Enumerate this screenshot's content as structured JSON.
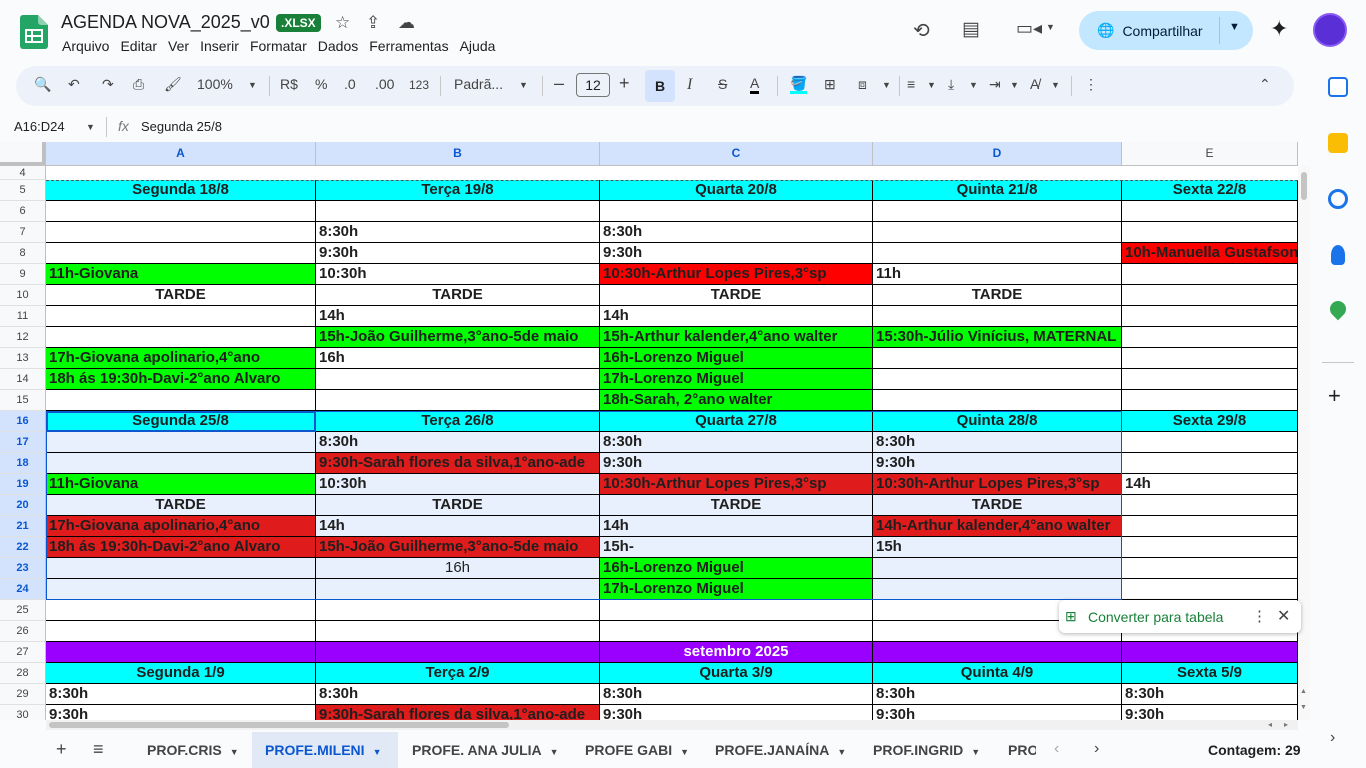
{
  "doc": {
    "title": "AGENDA NOVA_2025_v0",
    "badge": ".XLSX"
  },
  "menus": [
    "Arquivo",
    "Editar",
    "Ver",
    "Inserir",
    "Formatar",
    "Dados",
    "Ferramentas",
    "Ajuda"
  ],
  "share": {
    "label": "Compartilhar"
  },
  "toolbar": {
    "zoom": "100%",
    "currency": "R$",
    "percent": "%",
    "dec_less": ".0",
    "dec_more": ".00",
    "format_num": "123",
    "font": "Padrã...",
    "font_size": "12",
    "minus": "–",
    "plus": "+"
  },
  "formula_bar": {
    "name_box": "A16:D24",
    "fx": "fx",
    "content": "Segunda 25/8"
  },
  "columns": [
    "A",
    "B",
    "C",
    "D",
    "E"
  ],
  "rows": [
    "4",
    "5",
    "6",
    "7",
    "8",
    "9",
    "10",
    "11",
    "12",
    "13",
    "14",
    "15",
    "16",
    "17",
    "18",
    "19",
    "20",
    "21",
    "22",
    "23",
    "24",
    "25",
    "26",
    "27",
    "28",
    "29",
    "30"
  ],
  "colors": {
    "cyan": "#00ffff",
    "green": "#00ff00",
    "red": "#ff0000",
    "red_dark": "#e01b1b",
    "purple": "#9900ff",
    "selection": "#e8f0fe",
    "accent": "#0b57d0"
  },
  "cells": [
    {
      "r": 5,
      "c": 0,
      "t": "Segunda 18/8",
      "bg": "cyan",
      "ctr": true
    },
    {
      "r": 5,
      "c": 1,
      "t": "Terça 19/8",
      "bg": "cyan",
      "ctr": true
    },
    {
      "r": 5,
      "c": 2,
      "t": "Quarta 20/8",
      "bg": "cyan",
      "ctr": true
    },
    {
      "r": 5,
      "c": 3,
      "t": "Quinta 21/8",
      "bg": "cyan",
      "ctr": true
    },
    {
      "r": 5,
      "c": 4,
      "t": "Sexta 22/8",
      "bg": "cyan",
      "ctr": true
    },
    {
      "r": 7,
      "c": 1,
      "t": "8:30h"
    },
    {
      "r": 7,
      "c": 2,
      "t": "8:30h"
    },
    {
      "r": 8,
      "c": 1,
      "t": "9:30h"
    },
    {
      "r": 8,
      "c": 2,
      "t": "9:30h"
    },
    {
      "r": 8,
      "c": 4,
      "t": "10h-Manuella Gustafson",
      "bg": "red"
    },
    {
      "r": 9,
      "c": 0,
      "t": "11h-Giovana",
      "bg": "green"
    },
    {
      "r": 9,
      "c": 1,
      "t": "10:30h"
    },
    {
      "r": 9,
      "c": 2,
      "t": "10:30h-Arthur Lopes Pires,3°sp",
      "bg": "red"
    },
    {
      "r": 9,
      "c": 3,
      "t": "11h"
    },
    {
      "r": 10,
      "c": 0,
      "t": "TARDE",
      "ctr": true
    },
    {
      "r": 10,
      "c": 1,
      "t": "TARDE",
      "ctr": true
    },
    {
      "r": 10,
      "c": 2,
      "t": "TARDE",
      "ctr": true
    },
    {
      "r": 10,
      "c": 3,
      "t": "TARDE",
      "ctr": true
    },
    {
      "r": 11,
      "c": 1,
      "t": "14h"
    },
    {
      "r": 11,
      "c": 2,
      "t": "14h"
    },
    {
      "r": 12,
      "c": 1,
      "t": "15h-João Guilherme,3°ano-5de maio",
      "bg": "green"
    },
    {
      "r": 12,
      "c": 2,
      "t": "15h-Arthur kalender,4°ano walter",
      "bg": "green"
    },
    {
      "r": 12,
      "c": 3,
      "t": "15:30h-Júlio Vinícius, MATERNAL",
      "bg": "green"
    },
    {
      "r": 13,
      "c": 0,
      "t": "17h-Giovana apolinario,4°ano",
      "bg": "green"
    },
    {
      "r": 13,
      "c": 1,
      "t": "16h"
    },
    {
      "r": 13,
      "c": 2,
      "t": "16h-Lorenzo Miguel",
      "bg": "green"
    },
    {
      "r": 14,
      "c": 0,
      "t": "18h ás 19:30h-Davi-2°ano Alvaro",
      "bg": "green"
    },
    {
      "r": 14,
      "c": 2,
      "t": "17h-Lorenzo Miguel",
      "bg": "green"
    },
    {
      "r": 15,
      "c": 2,
      "t": "18h-Sarah, 2°ano walter",
      "bg": "green"
    },
    {
      "r": 16,
      "c": 0,
      "t": "Segunda 25/8",
      "bg": "cyan",
      "ctr": true
    },
    {
      "r": 16,
      "c": 1,
      "t": "Terça 26/8",
      "bg": "cyan",
      "ctr": true
    },
    {
      "r": 16,
      "c": 2,
      "t": "Quarta 27/8",
      "bg": "cyan",
      "ctr": true
    },
    {
      "r": 16,
      "c": 3,
      "t": "Quinta 28/8",
      "bg": "cyan",
      "ctr": true
    },
    {
      "r": 16,
      "c": 4,
      "t": "Sexta 29/8",
      "bg": "cyan",
      "ctr": true
    },
    {
      "r": 17,
      "c": 1,
      "t": "8:30h"
    },
    {
      "r": 17,
      "c": 2,
      "t": "8:30h"
    },
    {
      "r": 17,
      "c": 3,
      "t": "8:30h"
    },
    {
      "r": 18,
      "c": 1,
      "t": "9:30h-Sarah flores da silva,1°ano-ade",
      "bg": "red_dark"
    },
    {
      "r": 18,
      "c": 2,
      "t": "9:30h"
    },
    {
      "r": 18,
      "c": 3,
      "t": "9:30h"
    },
    {
      "r": 19,
      "c": 0,
      "t": "11h-Giovana",
      "bg": "green"
    },
    {
      "r": 19,
      "c": 1,
      "t": "10:30h"
    },
    {
      "r": 19,
      "c": 2,
      "t": "10:30h-Arthur Lopes Pires,3°sp",
      "bg": "red_dark"
    },
    {
      "r": 19,
      "c": 3,
      "t": "10:30h-Arthur Lopes Pires,3°sp",
      "bg": "red_dark"
    },
    {
      "r": 19,
      "c": 4,
      "t": "14h"
    },
    {
      "r": 20,
      "c": 0,
      "t": "TARDE",
      "ctr": true
    },
    {
      "r": 20,
      "c": 1,
      "t": "TARDE",
      "ctr": true
    },
    {
      "r": 20,
      "c": 2,
      "t": "TARDE",
      "ctr": true
    },
    {
      "r": 20,
      "c": 3,
      "t": "TARDE",
      "ctr": true
    },
    {
      "r": 21,
      "c": 0,
      "t": "17h-Giovana apolinario,4°ano",
      "bg": "red_dark"
    },
    {
      "r": 21,
      "c": 1,
      "t": "14h"
    },
    {
      "r": 21,
      "c": 2,
      "t": "14h"
    },
    {
      "r": 21,
      "c": 3,
      "t": "14h-Arthur kalender,4°ano walter",
      "bg": "red_dark"
    },
    {
      "r": 22,
      "c": 0,
      "t": "18h ás 19:30h-Davi-2°ano Alvaro",
      "bg": "red_dark"
    },
    {
      "r": 22,
      "c": 1,
      "t": "15h-João Guilherme,3°ano-5de maio",
      "bg": "red_dark"
    },
    {
      "r": 22,
      "c": 2,
      "t": "15h-"
    },
    {
      "r": 22,
      "c": 3,
      "t": "15h"
    },
    {
      "r": 23,
      "c": 1,
      "t": "16h",
      "ctr": true,
      "norm": true
    },
    {
      "r": 23,
      "c": 2,
      "t": "16h-Lorenzo Miguel",
      "bg": "green"
    },
    {
      "r": 24,
      "c": 2,
      "t": "17h-Lorenzo Miguel",
      "bg": "green"
    },
    {
      "r": 27,
      "c": 0,
      "t": "",
      "bg": "purple"
    },
    {
      "r": 27,
      "c": 1,
      "t": "",
      "bg": "purple"
    },
    {
      "r": 27,
      "c": 2,
      "t": "setembro 2025",
      "bg": "purple",
      "ctr": true,
      "white": true
    },
    {
      "r": 27,
      "c": 3,
      "t": "",
      "bg": "purple"
    },
    {
      "r": 27,
      "c": 4,
      "t": "",
      "bg": "purple"
    },
    {
      "r": 28,
      "c": 0,
      "t": "Segunda 1/9",
      "bg": "cyan",
      "ctr": true
    },
    {
      "r": 28,
      "c": 1,
      "t": "Terça 2/9",
      "bg": "cyan",
      "ctr": true
    },
    {
      "r": 28,
      "c": 2,
      "t": "Quarta 3/9",
      "bg": "cyan",
      "ctr": true
    },
    {
      "r": 28,
      "c": 3,
      "t": "Quinta 4/9",
      "bg": "cyan",
      "ctr": true
    },
    {
      "r": 28,
      "c": 4,
      "t": "Sexta 5/9",
      "bg": "cyan",
      "ctr": true
    },
    {
      "r": 29,
      "c": 0,
      "t": "8:30h"
    },
    {
      "r": 29,
      "c": 1,
      "t": "8:30h"
    },
    {
      "r": 29,
      "c": 2,
      "t": "8:30h"
    },
    {
      "r": 29,
      "c": 3,
      "t": "8:30h"
    },
    {
      "r": 29,
      "c": 4,
      "t": "8:30h"
    },
    {
      "r": 30,
      "c": 0,
      "t": "9:30h"
    },
    {
      "r": 30,
      "c": 1,
      "t": "9:30h-Sarah flores da silva,1°ano-ade",
      "bg": "red_dark"
    },
    {
      "r": 30,
      "c": 2,
      "t": "9:30h"
    },
    {
      "r": 30,
      "c": 3,
      "t": "9:30h"
    },
    {
      "r": 30,
      "c": 4,
      "t": "9:30h"
    }
  ],
  "popup": {
    "label": "Converter para tabela"
  },
  "tabs": [
    {
      "label": "PROF.CRIS"
    },
    {
      "label": "PROFE.MILENI",
      "active": true
    },
    {
      "label": "PROFE. ANA JULIA"
    },
    {
      "label": "PROFE GABI"
    },
    {
      "label": "PROFE.JANAÍNA"
    },
    {
      "label": "PROF.INGRID"
    },
    {
      "label": "PRO"
    }
  ],
  "status": {
    "count": "Contagem: 29"
  }
}
